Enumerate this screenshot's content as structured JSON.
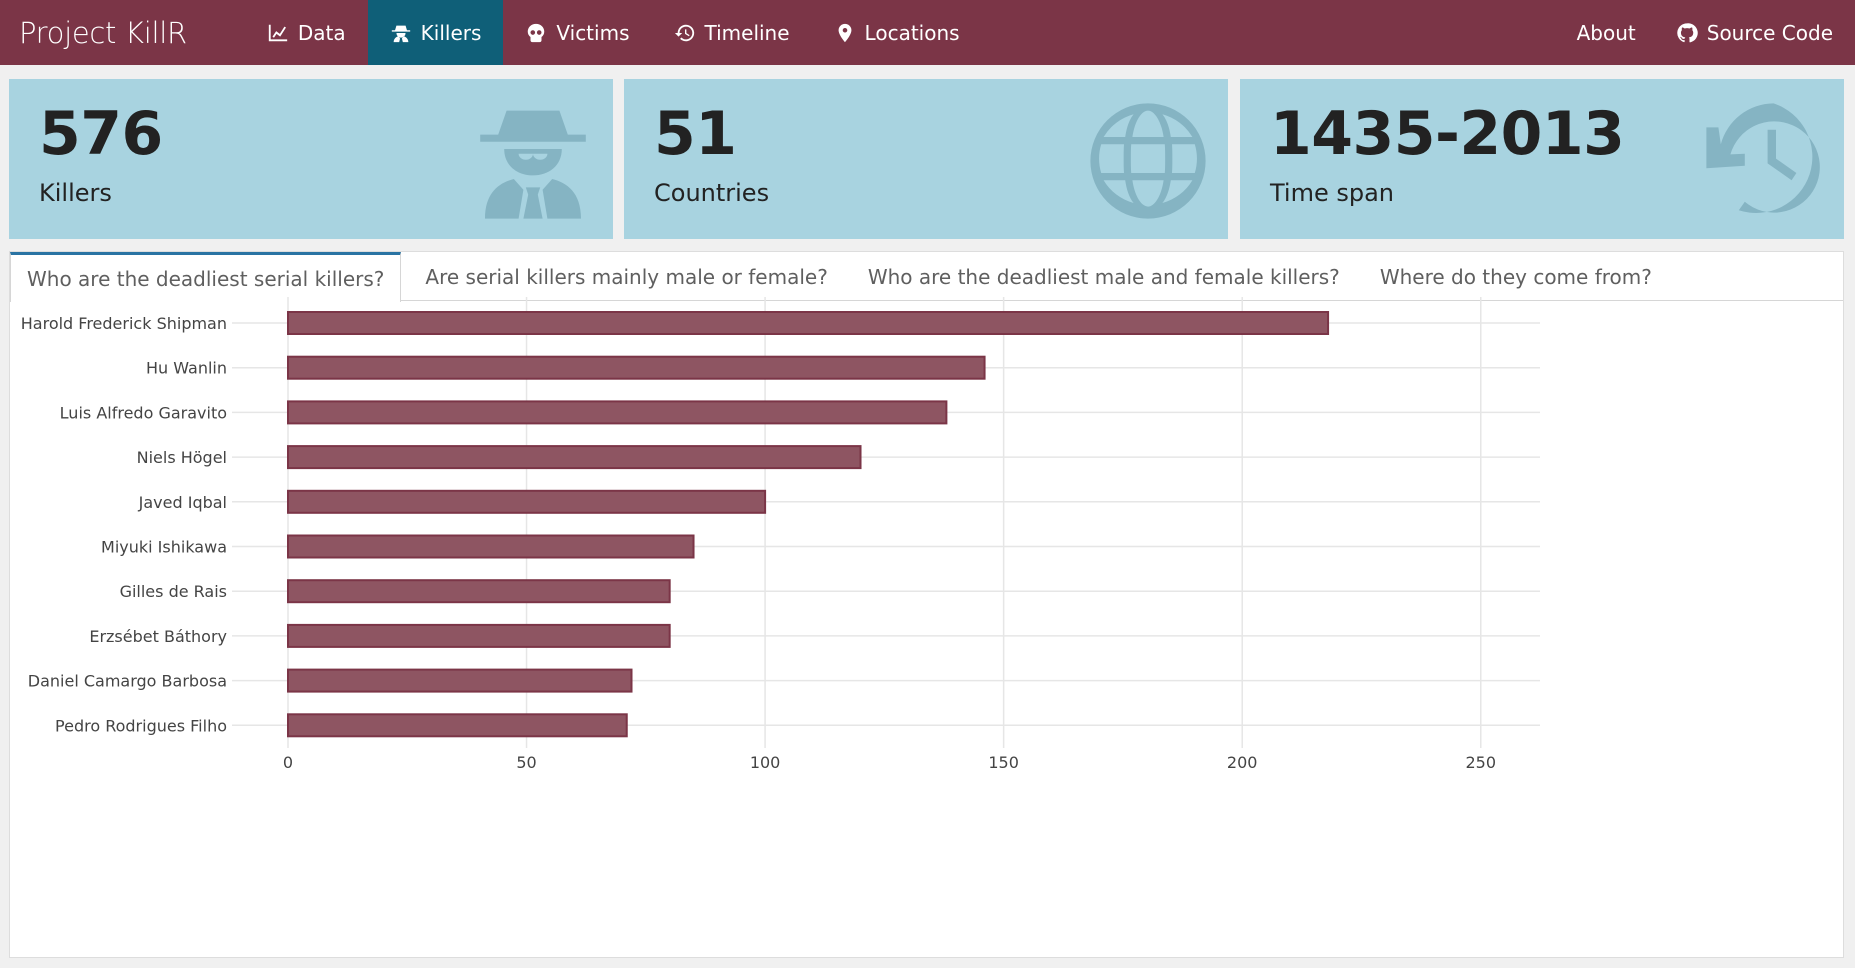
{
  "navbar": {
    "brand": "Project KillR",
    "items": [
      {
        "label": "Data",
        "icon": "chart-line-icon",
        "active": false
      },
      {
        "label": "Killers",
        "icon": "user-secret-icon",
        "active": true
      },
      {
        "label": "Victims",
        "icon": "skull-icon",
        "active": false
      },
      {
        "label": "Timeline",
        "icon": "history-icon",
        "active": false
      },
      {
        "label": "Locations",
        "icon": "map-marker-icon",
        "active": false
      }
    ],
    "right": [
      {
        "label": "About"
      },
      {
        "label": "Source Code",
        "icon": "github-icon"
      }
    ]
  },
  "stats": [
    {
      "value": "576",
      "label": "Killers",
      "icon": "user-secret-icon"
    },
    {
      "value": "51",
      "label": "Countries",
      "icon": "globe-icon"
    },
    {
      "value": "1435-2013",
      "label": "Time span",
      "icon": "history-icon"
    }
  ],
  "tabs": [
    {
      "label": "Who are the deadliest serial killers?",
      "active": true
    },
    {
      "label": "Are serial killers mainly male or female?",
      "active": false
    },
    {
      "label": "Who are the deadliest male and female killers?",
      "active": false
    },
    {
      "label": "Where do they come from?",
      "active": false
    }
  ],
  "colors": {
    "navbar": "#7b3547",
    "nav_active": "#0f5f78",
    "stat_box": "#a8d3e0",
    "bar_fill": "#8e5562",
    "bar_stroke": "#7b3547"
  },
  "chart_data": {
    "type": "bar",
    "orientation": "horizontal",
    "categories": [
      "Harold Frederick Shipman",
      "Hu Wanlin",
      "Luis Alfredo Garavito",
      "Niels Högel",
      "Javed Iqbal",
      "Miyuki Ishikawa",
      "Gilles de Rais",
      "Erzsébet Báthory",
      "Daniel Camargo Barbosa",
      "Pedro Rodrigues Filho"
    ],
    "values": [
      218,
      146,
      138,
      120,
      100,
      85,
      80,
      80,
      72,
      71
    ],
    "xticks": [
      0,
      50,
      100,
      150,
      200,
      250
    ],
    "xlim": [
      0,
      262
    ],
    "grid": true
  }
}
